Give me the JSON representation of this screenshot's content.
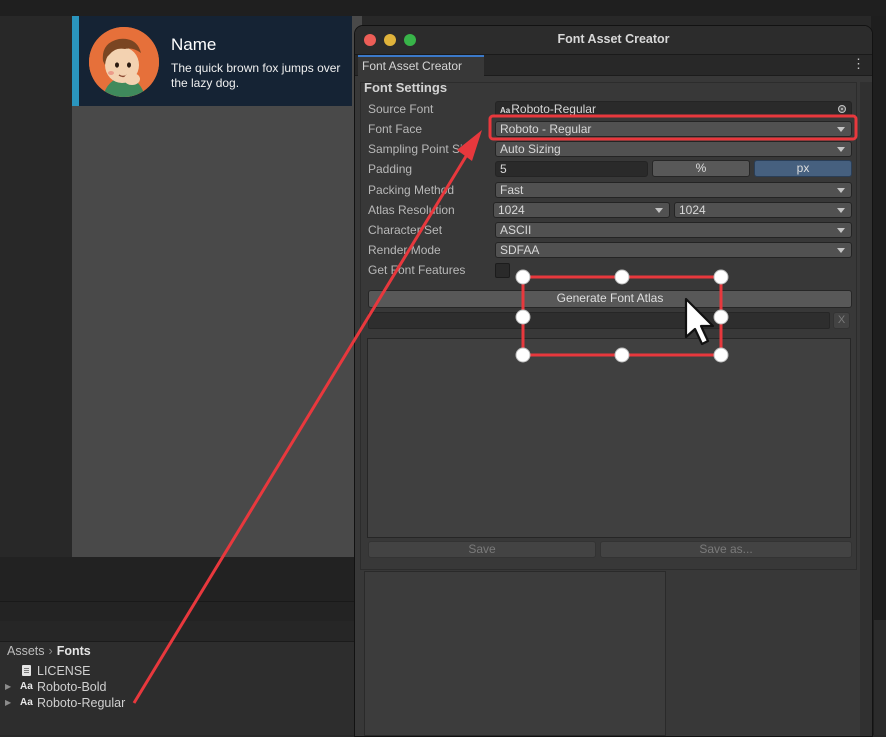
{
  "card": {
    "name": "Name",
    "text": "The quick brown fox jumps over the lazy dog."
  },
  "project": {
    "breadcrumb": [
      "Assets",
      "Fonts"
    ],
    "items": [
      {
        "label": "LICENSE",
        "icon": "document-icon",
        "expandable": false
      },
      {
        "label": "Roboto-Bold",
        "icon": "font-asset-icon",
        "expandable": true
      },
      {
        "label": "Roboto-Regular",
        "icon": "font-asset-icon",
        "expandable": true
      }
    ]
  },
  "window": {
    "title": "Font Asset Creator",
    "tab": "Font Asset Creator",
    "section": "Font Settings",
    "traffic_lights": {
      "close": "#ed5e57",
      "minimize": "#e0b33b",
      "zoom": "#38b449"
    },
    "fields": {
      "source_font": {
        "label": "Source Font",
        "value": "Roboto-Regular",
        "icon": "Aa"
      },
      "font_face": {
        "label": "Font Face",
        "value": "Roboto - Regular"
      },
      "sampling_point_size": {
        "label": "Sampling Point Size",
        "value": "Auto Sizing"
      },
      "padding": {
        "label": "Padding",
        "value": "5",
        "unit_percent": "%",
        "unit_px": "px",
        "selected_unit": "px"
      },
      "packing_method": {
        "label": "Packing Method",
        "value": "Fast"
      },
      "atlas_resolution": {
        "label": "Atlas Resolution",
        "width": "1024",
        "height": "1024"
      },
      "character_set": {
        "label": "Character Set",
        "value": "ASCII"
      },
      "render_mode": {
        "label": "Render Mode",
        "value": "SDFAA"
      },
      "get_font_features": {
        "label": "Get Font Features",
        "checked": false
      }
    },
    "generate_button": "Generate Font Atlas",
    "clear_button": "X",
    "save_button": "Save",
    "save_as_button": "Save as..."
  },
  "annotation": {
    "color": "#e8383d"
  }
}
